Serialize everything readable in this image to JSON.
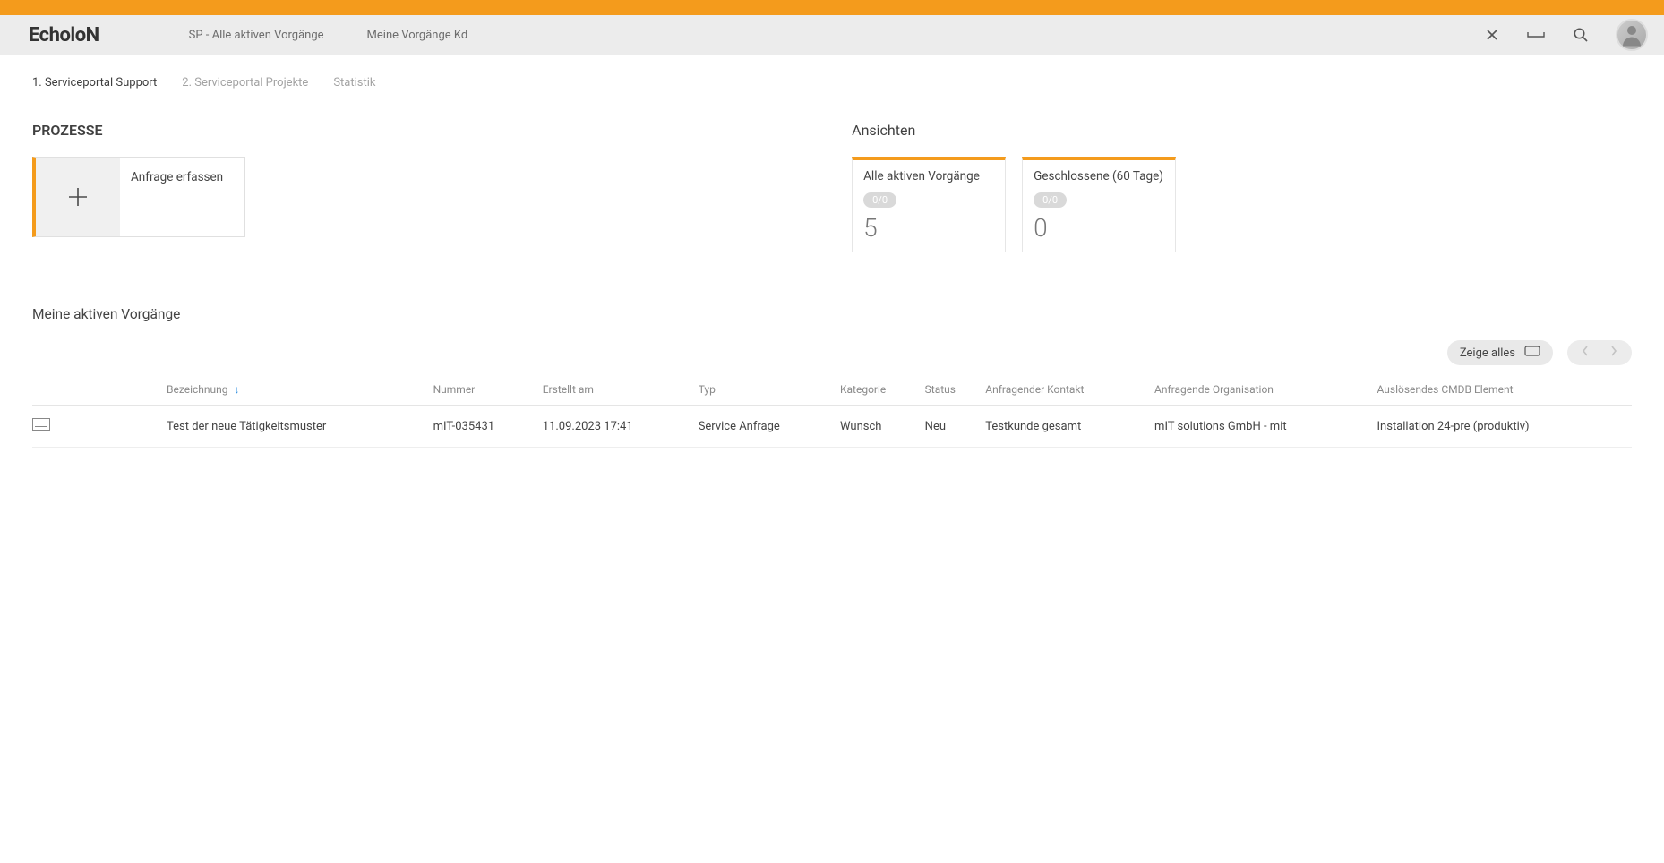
{
  "header": {
    "logo": "EcholoN",
    "breadcrumbs": [
      "SP - Alle aktiven Vorgänge",
      "Meine Vorgänge Kd"
    ]
  },
  "tabs": [
    {
      "label": "1. Serviceportal Support",
      "active": true
    },
    {
      "label": "2. Serviceportal Projekte",
      "active": false
    },
    {
      "label": "Statistik",
      "active": false
    }
  ],
  "processes": {
    "title": "PROZESSE",
    "card_label": "Anfrage erfassen"
  },
  "views": {
    "title": "Ansichten",
    "cards": [
      {
        "title": "Alle aktiven Vorgänge",
        "badge": "0/0",
        "count": "5"
      },
      {
        "title": "Geschlossene (60 Tage)",
        "badge": "0/0",
        "count": "0"
      }
    ]
  },
  "table": {
    "title": "Meine aktiven Vorgänge",
    "show_all_label": "Zeige alles",
    "columns": [
      "Bezeichnung",
      "Nummer",
      "Erstellt am",
      "Typ",
      "Kategorie",
      "Status",
      "Anfragender Kontakt",
      "Anfragende Organisation",
      "Auslösendes CMDB Element"
    ],
    "sort_col_index": 0,
    "rows": [
      {
        "bezeichnung": "Test der neue Tätigkeitsmuster",
        "nummer": "mIT-035431",
        "erstellt_am": "11.09.2023 17:41",
        "typ": "Service Anfrage",
        "kategorie": "Wunsch",
        "status": "Neu",
        "kontakt": "Testkunde gesamt",
        "organisation": "mIT solutions GmbH - mit",
        "cmdb": "Installation 24-pre (produktiv)"
      }
    ]
  }
}
